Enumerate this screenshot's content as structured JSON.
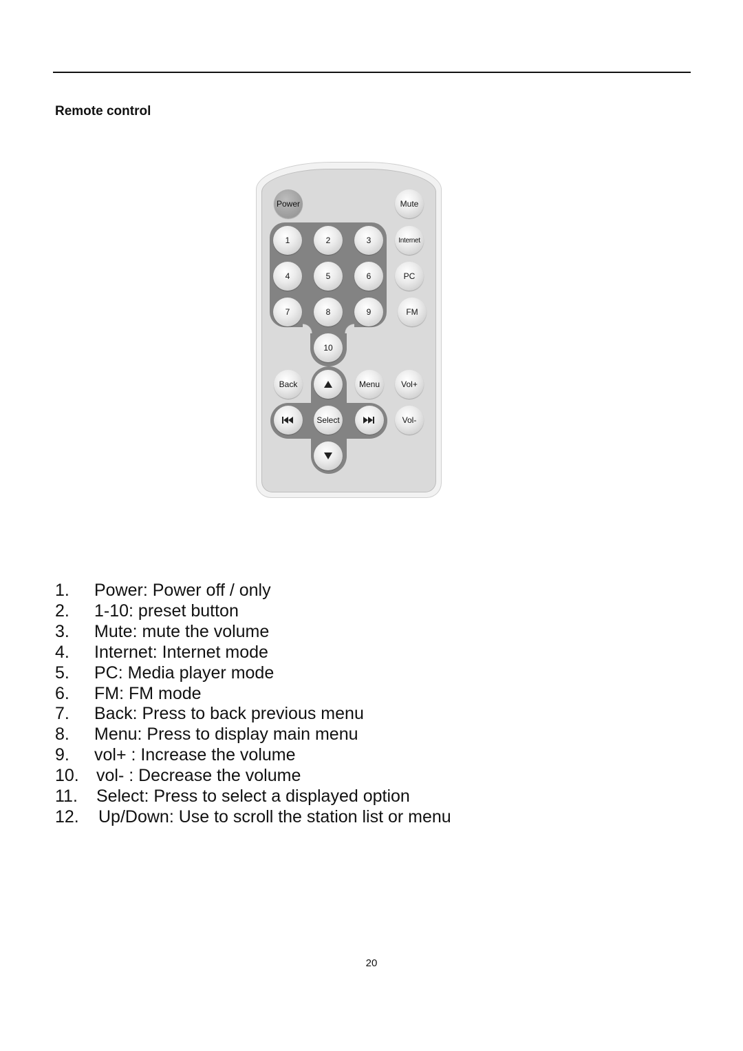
{
  "section_title": "Remote control",
  "remote": {
    "buttons": {
      "power": "Power",
      "mute": "Mute",
      "internet": "Internet",
      "pc": "PC",
      "fm": "FM",
      "preset_1": "1",
      "preset_2": "2",
      "preset_3": "3",
      "preset_4": "4",
      "preset_5": "5",
      "preset_6": "6",
      "preset_7": "7",
      "preset_8": "8",
      "preset_9": "9",
      "preset_10": "10",
      "back": "Back",
      "menu": "Menu",
      "vol_up": "Vol+",
      "vol_down": "Vol-",
      "select": "Select"
    },
    "icons": {
      "up": "triangle-up-icon",
      "down": "triangle-down-icon",
      "previous": "skip-previous-icon",
      "next": "skip-next-icon"
    },
    "colors": {
      "body": "#dadada",
      "pad": "#838383",
      "power_button": "#a5a5a5"
    }
  },
  "legend": [
    {
      "num": "1.",
      "text": "Power:  Power off / only"
    },
    {
      "num": "2.",
      "text": "1-10: preset button"
    },
    {
      "num": "3.",
      "text": "Mute: mute the volume"
    },
    {
      "num": "4.",
      "text": "Internet: Internet mode"
    },
    {
      "num": "5.",
      "text": "PC: Media player mode"
    },
    {
      "num": "6.",
      "text": "FM: FM mode"
    },
    {
      "num": "7.",
      "text": "Back: Press to back previous menu"
    },
    {
      "num": "8.",
      "text": "Menu: Press to display main menu"
    },
    {
      "num": "9.",
      "text": "vol+ : Increase the volume"
    },
    {
      "num": "10.",
      "text": "vol- : Decrease the volume"
    },
    {
      "num": "11.",
      "text": "Select: Press to select a displayed option"
    },
    {
      "num": "12.",
      "text": "Up/Down: Use to scroll the station list or menu"
    }
  ],
  "page_number": "20"
}
